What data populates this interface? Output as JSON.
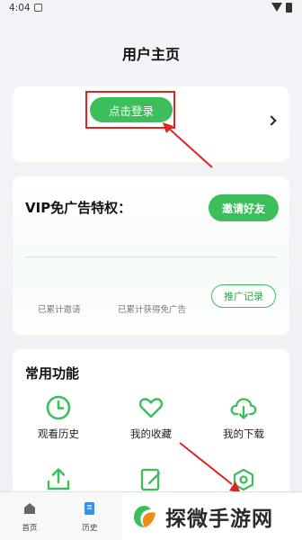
{
  "status": {
    "time": "4:04"
  },
  "page": {
    "title": "用户主页"
  },
  "login": {
    "button": "点击登录"
  },
  "vip": {
    "title": "VIP免广告特权：",
    "invite": "邀请好友",
    "stat_invited": "已累计邀请",
    "stat_adfree": "已累计获得免广告",
    "record": "推广记录"
  },
  "functions": {
    "title": "常用功能",
    "items": [
      {
        "label": "观看历史",
        "icon": "clock-icon"
      },
      {
        "label": "我的收藏",
        "icon": "heart-icon"
      },
      {
        "label": "我的下载",
        "icon": "cloud-download-icon"
      }
    ]
  },
  "nav": {
    "items": [
      {
        "label": "首页",
        "icon": "home-icon"
      },
      {
        "label": "历史",
        "icon": "history-icon"
      }
    ]
  },
  "watermark": {
    "text": "探微手游网"
  },
  "colors": {
    "accent": "#3dbe5c",
    "highlight": "#e02424"
  }
}
